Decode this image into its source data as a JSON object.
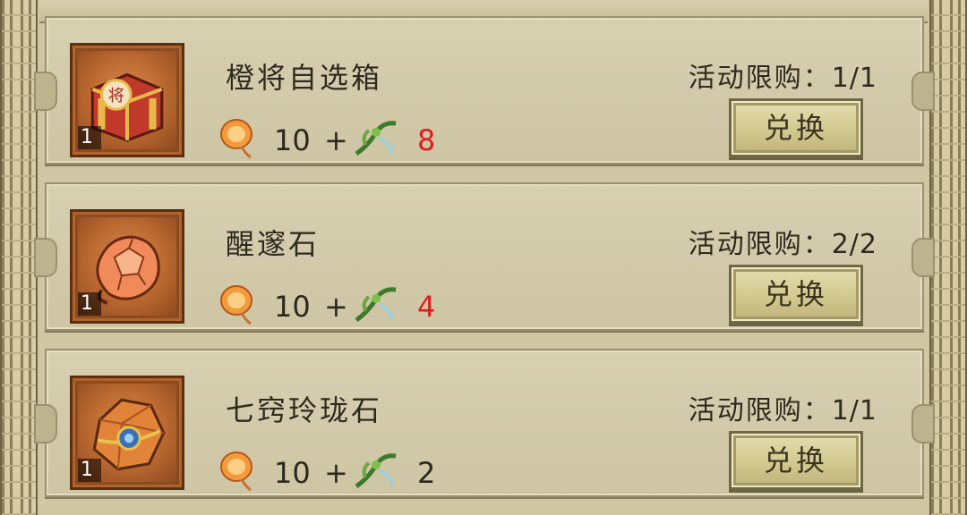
{
  "items": [
    {
      "name": "橙将自选箱",
      "icon": "orange-general-chest-icon",
      "quantity": "1",
      "cost_base": "10",
      "plus": "+",
      "cost_extra": "8",
      "extra_insufficient": true,
      "limit_label": "活动限购：",
      "limit_value": "1/1",
      "button_label": "兑换"
    },
    {
      "name": "醒邃石",
      "icon": "awakening-stone-icon",
      "quantity": "1",
      "cost_base": "10",
      "plus": "+",
      "cost_extra": "4",
      "extra_insufficient": true,
      "limit_label": "活动限购：",
      "limit_value": "2/2",
      "button_label": "兑换"
    },
    {
      "name": "七窍玲珑石",
      "icon": "exquisite-stone-icon",
      "quantity": "1",
      "cost_base": "10",
      "plus": "+",
      "cost_extra": "2",
      "extra_insufficient": false,
      "limit_label": "活动限购：",
      "limit_value": "1/1",
      "button_label": "兑换"
    }
  ],
  "currency_icons": [
    "lantern-icon",
    "herb-icon"
  ],
  "colors": {
    "insufficient": "#e01e1e",
    "frame": "#8a4a22",
    "button": "#d2c98e"
  }
}
